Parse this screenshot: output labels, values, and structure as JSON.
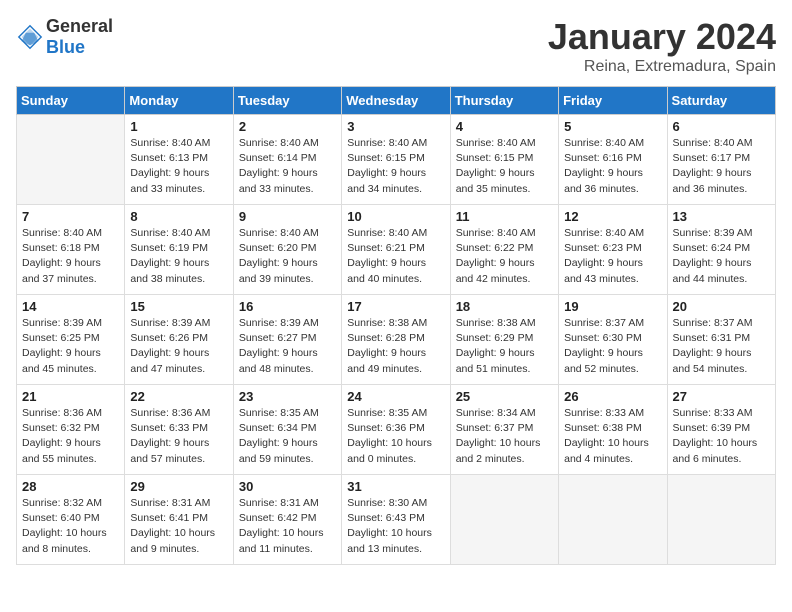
{
  "header": {
    "logo_general": "General",
    "logo_blue": "Blue",
    "month_year": "January 2024",
    "location": "Reina, Extremadura, Spain"
  },
  "weekdays": [
    "Sunday",
    "Monday",
    "Tuesday",
    "Wednesday",
    "Thursday",
    "Friday",
    "Saturday"
  ],
  "weeks": [
    [
      {
        "day": "",
        "info": ""
      },
      {
        "day": "1",
        "info": "Sunrise: 8:40 AM\nSunset: 6:13 PM\nDaylight: 9 hours\nand 33 minutes."
      },
      {
        "day": "2",
        "info": "Sunrise: 8:40 AM\nSunset: 6:14 PM\nDaylight: 9 hours\nand 33 minutes."
      },
      {
        "day": "3",
        "info": "Sunrise: 8:40 AM\nSunset: 6:15 PM\nDaylight: 9 hours\nand 34 minutes."
      },
      {
        "day": "4",
        "info": "Sunrise: 8:40 AM\nSunset: 6:15 PM\nDaylight: 9 hours\nand 35 minutes."
      },
      {
        "day": "5",
        "info": "Sunrise: 8:40 AM\nSunset: 6:16 PM\nDaylight: 9 hours\nand 36 minutes."
      },
      {
        "day": "6",
        "info": "Sunrise: 8:40 AM\nSunset: 6:17 PM\nDaylight: 9 hours\nand 36 minutes."
      }
    ],
    [
      {
        "day": "7",
        "info": "Sunrise: 8:40 AM\nSunset: 6:18 PM\nDaylight: 9 hours\nand 37 minutes."
      },
      {
        "day": "8",
        "info": "Sunrise: 8:40 AM\nSunset: 6:19 PM\nDaylight: 9 hours\nand 38 minutes."
      },
      {
        "day": "9",
        "info": "Sunrise: 8:40 AM\nSunset: 6:20 PM\nDaylight: 9 hours\nand 39 minutes."
      },
      {
        "day": "10",
        "info": "Sunrise: 8:40 AM\nSunset: 6:21 PM\nDaylight: 9 hours\nand 40 minutes."
      },
      {
        "day": "11",
        "info": "Sunrise: 8:40 AM\nSunset: 6:22 PM\nDaylight: 9 hours\nand 42 minutes."
      },
      {
        "day": "12",
        "info": "Sunrise: 8:40 AM\nSunset: 6:23 PM\nDaylight: 9 hours\nand 43 minutes."
      },
      {
        "day": "13",
        "info": "Sunrise: 8:39 AM\nSunset: 6:24 PM\nDaylight: 9 hours\nand 44 minutes."
      }
    ],
    [
      {
        "day": "14",
        "info": "Sunrise: 8:39 AM\nSunset: 6:25 PM\nDaylight: 9 hours\nand 45 minutes."
      },
      {
        "day": "15",
        "info": "Sunrise: 8:39 AM\nSunset: 6:26 PM\nDaylight: 9 hours\nand 47 minutes."
      },
      {
        "day": "16",
        "info": "Sunrise: 8:39 AM\nSunset: 6:27 PM\nDaylight: 9 hours\nand 48 minutes."
      },
      {
        "day": "17",
        "info": "Sunrise: 8:38 AM\nSunset: 6:28 PM\nDaylight: 9 hours\nand 49 minutes."
      },
      {
        "day": "18",
        "info": "Sunrise: 8:38 AM\nSunset: 6:29 PM\nDaylight: 9 hours\nand 51 minutes."
      },
      {
        "day": "19",
        "info": "Sunrise: 8:37 AM\nSunset: 6:30 PM\nDaylight: 9 hours\nand 52 minutes."
      },
      {
        "day": "20",
        "info": "Sunrise: 8:37 AM\nSunset: 6:31 PM\nDaylight: 9 hours\nand 54 minutes."
      }
    ],
    [
      {
        "day": "21",
        "info": "Sunrise: 8:36 AM\nSunset: 6:32 PM\nDaylight: 9 hours\nand 55 minutes."
      },
      {
        "day": "22",
        "info": "Sunrise: 8:36 AM\nSunset: 6:33 PM\nDaylight: 9 hours\nand 57 minutes."
      },
      {
        "day": "23",
        "info": "Sunrise: 8:35 AM\nSunset: 6:34 PM\nDaylight: 9 hours\nand 59 minutes."
      },
      {
        "day": "24",
        "info": "Sunrise: 8:35 AM\nSunset: 6:36 PM\nDaylight: 10 hours\nand 0 minutes."
      },
      {
        "day": "25",
        "info": "Sunrise: 8:34 AM\nSunset: 6:37 PM\nDaylight: 10 hours\nand 2 minutes."
      },
      {
        "day": "26",
        "info": "Sunrise: 8:33 AM\nSunset: 6:38 PM\nDaylight: 10 hours\nand 4 minutes."
      },
      {
        "day": "27",
        "info": "Sunrise: 8:33 AM\nSunset: 6:39 PM\nDaylight: 10 hours\nand 6 minutes."
      }
    ],
    [
      {
        "day": "28",
        "info": "Sunrise: 8:32 AM\nSunset: 6:40 PM\nDaylight: 10 hours\nand 8 minutes."
      },
      {
        "day": "29",
        "info": "Sunrise: 8:31 AM\nSunset: 6:41 PM\nDaylight: 10 hours\nand 9 minutes."
      },
      {
        "day": "30",
        "info": "Sunrise: 8:31 AM\nSunset: 6:42 PM\nDaylight: 10 hours\nand 11 minutes."
      },
      {
        "day": "31",
        "info": "Sunrise: 8:30 AM\nSunset: 6:43 PM\nDaylight: 10 hours\nand 13 minutes."
      },
      {
        "day": "",
        "info": ""
      },
      {
        "day": "",
        "info": ""
      },
      {
        "day": "",
        "info": ""
      }
    ]
  ]
}
